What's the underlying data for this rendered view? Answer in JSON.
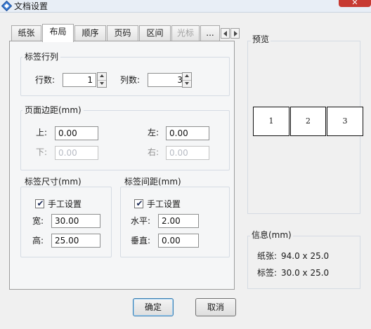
{
  "window": {
    "title": "文档设置",
    "close_symbol": "✕"
  },
  "tabs": [
    {
      "label": "纸张",
      "active": false,
      "disabled": false
    },
    {
      "label": "布局",
      "active": true,
      "disabled": false
    },
    {
      "label": "顺序",
      "active": false,
      "disabled": false
    },
    {
      "label": "页码",
      "active": false,
      "disabled": false
    },
    {
      "label": "区间",
      "active": false,
      "disabled": false
    },
    {
      "label": "光标",
      "active": false,
      "disabled": true
    },
    {
      "label": "...",
      "active": false,
      "disabled": false
    }
  ],
  "label_rows_cols": {
    "title": "标签行列",
    "rows_label": "行数:",
    "rows_value": "1",
    "cols_label": "列数:",
    "cols_value": "3"
  },
  "page_margins": {
    "title": "页面边距(mm)",
    "top_label": "上:",
    "top_value": "0.00",
    "bottom_label": "下:",
    "bottom_value": "0.00",
    "left_label": "左:",
    "left_value": "0.00",
    "right_label": "右:",
    "right_value": "0.00"
  },
  "label_size": {
    "title": "标签尺寸(mm)",
    "manual_label": "手工设置",
    "manual_checked": true,
    "width_label": "宽:",
    "width_value": "30.00",
    "height_label": "高:",
    "height_value": "25.00"
  },
  "label_spacing": {
    "title": "标签间距(mm)",
    "manual_label": "手工设置",
    "manual_checked": true,
    "horizontal_label": "水平:",
    "horizontal_value": "2.00",
    "vertical_label": "垂直:",
    "vertical_value": "0.00"
  },
  "preview": {
    "title": "预览",
    "cells": [
      "1",
      "2",
      "3"
    ]
  },
  "info": {
    "title": "信息(mm)",
    "paper_label": "纸张:",
    "paper_value": "94.0 x 25.0",
    "label_label": "标签:",
    "label_value": "30.0 x 25.0"
  },
  "buttons": {
    "ok": "确定",
    "cancel": "取消"
  },
  "icons": {
    "app": "diamond-app-icon",
    "close": "close-icon",
    "tab_left": "arrow-left-icon",
    "tab_right": "arrow-right-icon",
    "checkmark": "checkmark-icon",
    "spin_up": "spin-up-icon",
    "spin_down": "spin-down-icon"
  },
  "colors": {
    "close_button": "#c73a32",
    "accent": "#3c7fb1",
    "check_mark": "#1b2a55"
  }
}
